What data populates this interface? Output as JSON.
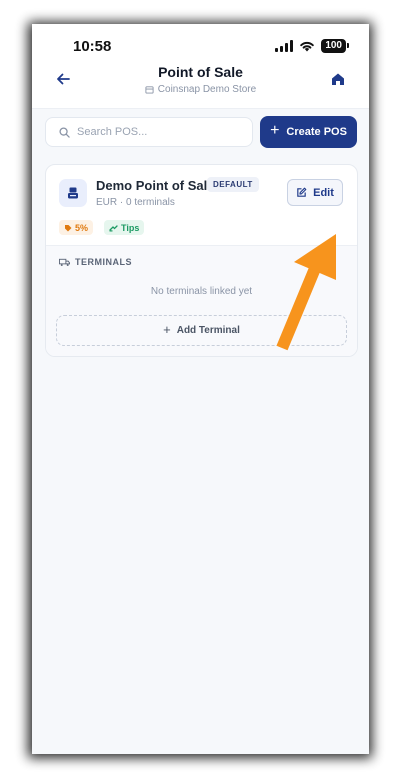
{
  "status_bar": {
    "time": "10:58",
    "battery": "100"
  },
  "header": {
    "title": "Point of Sale",
    "store": "Coinsnap Demo Store"
  },
  "search": {
    "placeholder": "Search POS..."
  },
  "create_button": {
    "label": "Create POS"
  },
  "pos_card": {
    "name": "Demo Point of Sale",
    "badge": "DEFAULT",
    "meta": "EUR · 0 terminals",
    "edit_label": "Edit",
    "tags": {
      "percent": "5%",
      "tips": "Tips"
    }
  },
  "terminals": {
    "heading": "TERMINALS",
    "empty_text": "No terminals linked yet",
    "add_label": "Add Terminal"
  },
  "colors": {
    "primary": "#1f3a8a",
    "annotation_arrow": "#f7941d",
    "tag_orange": "#e07a10",
    "tag_green": "#1c9a63"
  }
}
